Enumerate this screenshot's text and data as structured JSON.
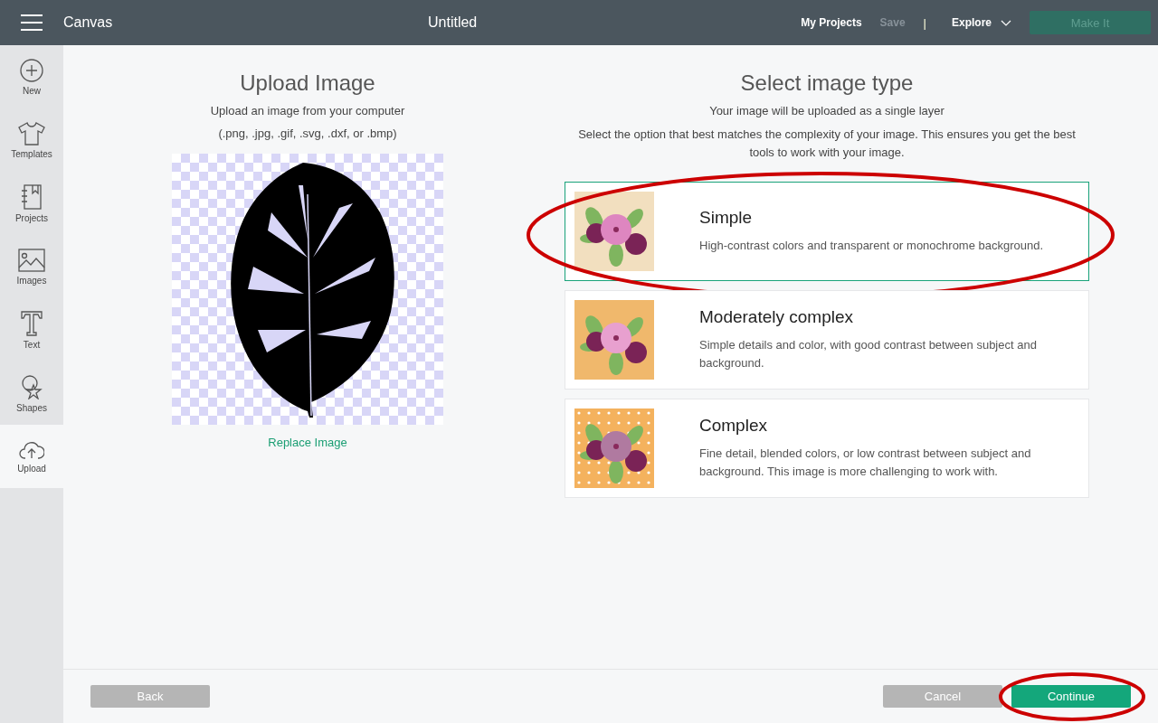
{
  "header": {
    "app_name": "Canvas",
    "title": "Untitled",
    "links": [
      {
        "label": "My Projects",
        "disabled": false
      },
      {
        "label": "Save",
        "disabled": true
      }
    ],
    "separator": "|",
    "explore": "Explore",
    "make_it": {
      "label": "Make It",
      "disabled": true
    }
  },
  "sidebar": {
    "items": [
      {
        "label": "New",
        "selected": false
      },
      {
        "label": "Templates",
        "selected": false
      },
      {
        "label": "Projects",
        "selected": false
      },
      {
        "label": "Images",
        "selected": false
      },
      {
        "label": "Text",
        "selected": false
      },
      {
        "label": "Shapes",
        "selected": false
      },
      {
        "label": "Upload",
        "selected": true
      }
    ]
  },
  "upload": {
    "title": "Upload Image",
    "subtitle": "Upload an image from your computer",
    "formats": "(.png, .jpg, .gif, .svg, .dxf, or .bmp)",
    "replace_link": "Replace Image"
  },
  "image_type": {
    "title": "Select image type",
    "subtitle": "Your image will be uploaded as a single layer",
    "description": "Select the option that best matches the complexity of your image. This ensures you get the best tools to work with your image.",
    "options": [
      {
        "title": "Simple",
        "description": "High-contrast colors and transparent or monochrome background.",
        "selected": true,
        "circled": true
      },
      {
        "title": "Moderately complex",
        "description": "Simple details and color, with good contrast between subject and background.",
        "selected": false,
        "circled": false
      },
      {
        "title": "Complex",
        "description": "Fine detail, blended colors, or low contrast between subject and background. This image is more challenging to work with.",
        "selected": false,
        "circled": false
      }
    ]
  },
  "footer": {
    "back": "Back",
    "cancel": "Cancel",
    "continue": {
      "label": "Continue",
      "circled": true
    }
  }
}
